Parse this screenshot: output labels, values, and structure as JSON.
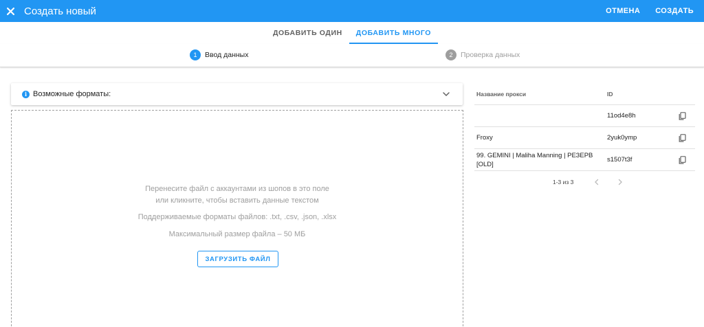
{
  "header": {
    "title": "Создать новый",
    "cancel_label": "ОТМЕНА",
    "create_label": "СОЗДАТЬ",
    "accent_color": "#2196f3"
  },
  "tabs": [
    {
      "label": "ДОБАВИТЬ ОДИН",
      "active": false
    },
    {
      "label": "ДОБАВИТЬ МНОГО",
      "active": true
    }
  ],
  "stepper": [
    {
      "number": "1",
      "label": "Ввод данных",
      "active": true
    },
    {
      "number": "2",
      "label": "Проверка данных",
      "active": false
    }
  ],
  "formats": {
    "label": "Возможные форматы:",
    "icon": "info-icon"
  },
  "dropzone": {
    "line1": "Перенесите файл с аккаунтами из шопов в это поле",
    "line2": "или кликните, чтобы вставить данные текстом",
    "supported": "Поддерживаемые форматы файлов: .txt, .csv, .json, .xlsx",
    "max_size": "Максимальный размер файла – 50 МБ",
    "upload_label": "ЗАГРУЗИТЬ ФАЙЛ"
  },
  "table": {
    "columns": [
      "Название прокси",
      "ID"
    ],
    "rows": [
      {
        "name_line1": "",
        "name_line2": "",
        "id": "11od4e8h"
      },
      {
        "name_line1": "Froxy",
        "name_line2": "",
        "id": "2yuk0ymp"
      },
      {
        "name_line1": "99. GEMINI | Maliha Manning | РЕЗЕРВ",
        "name_line2": "[OLD]",
        "id": "s1507t3f"
      }
    ],
    "pagination": "1-3 из 3"
  }
}
